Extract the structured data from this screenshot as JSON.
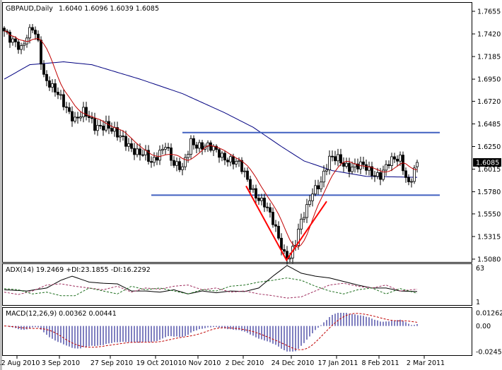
{
  "header": {
    "symbol": "GBPAUD,Daily",
    "ohlc": "1.6040 1.6096 1.6039 1.6085"
  },
  "adx_label": "ADX(14) 19.2469 +DI:23.1855 -DI:16.2292",
  "macd_label": "MACD(12,26,9) 0.00362 0.00441",
  "colors": {
    "bull": "#ffffff",
    "bear": "#000000",
    "ma_fast": "#c00000",
    "ma_slow": "#000080",
    "level": "#4060c0",
    "v_pattern": "#ff0000",
    "adx": "#000000",
    "plus_di": "#a03060",
    "minus_di": "#207020",
    "macd_hist": "#000080",
    "macd_signal": "#c00000"
  },
  "chart_data": {
    "type": "candlestick",
    "title": "GBPAUD,Daily",
    "price_axis": {
      "ticks": [
        "1.7655",
        "1.7420",
        "1.7185",
        "1.6950",
        "1.6720",
        "1.6485",
        "1.6250",
        "1.6015",
        "1.5780",
        "1.5550",
        "1.5315",
        "1.5080"
      ],
      "current": "1.6085"
    },
    "x_ticks": [
      {
        "bar": 5,
        "label": "12 Aug 2010"
      },
      {
        "bar": 20,
        "label": "3 Sep 2010"
      },
      {
        "bar": 38,
        "label": "27 Sep 2010"
      },
      {
        "bar": 54,
        "label": "19 Oct 2010"
      },
      {
        "bar": 69,
        "label": "10 Nov 2010"
      },
      {
        "bar": 85,
        "label": "2 Dec 2010"
      },
      {
        "bar": 102,
        "label": "24 Dec 2010"
      },
      {
        "bar": 118,
        "label": "17 Jan 2011"
      },
      {
        "bar": 133,
        "label": "8 Feb 2011"
      },
      {
        "bar": 149,
        "label": "2 Mar 2011"
      }
    ],
    "bars": 147,
    "close_anchors": [
      [
        0,
        1.745
      ],
      [
        4,
        1.735
      ],
      [
        6,
        1.725
      ],
      [
        10,
        1.748
      ],
      [
        12,
        1.735
      ],
      [
        14,
        1.7
      ],
      [
        17,
        1.685
      ],
      [
        22,
        1.665
      ],
      [
        25,
        1.655
      ],
      [
        28,
        1.66
      ],
      [
        32,
        1.645
      ],
      [
        36,
        1.65
      ],
      [
        40,
        1.635
      ],
      [
        45,
        1.625
      ],
      [
        50,
        1.615
      ],
      [
        52,
        1.605
      ],
      [
        55,
        1.62
      ],
      [
        57,
        1.63
      ],
      [
        60,
        1.605
      ],
      [
        63,
        1.6
      ],
      [
        66,
        1.632
      ],
      [
        70,
        1.625
      ],
      [
        75,
        1.62
      ],
      [
        80,
        1.612
      ],
      [
        83,
        1.605
      ],
      [
        85,
        1.595
      ],
      [
        88,
        1.58
      ],
      [
        92,
        1.565
      ],
      [
        95,
        1.545
      ],
      [
        97,
        1.53
      ],
      [
        99,
        1.515
      ],
      [
        101,
        1.512
      ],
      [
        103,
        1.525
      ],
      [
        105,
        1.545
      ],
      [
        107,
        1.56
      ],
      [
        109,
        1.58
      ],
      [
        112,
        1.59
      ],
      [
        115,
        1.61
      ],
      [
        118,
        1.612
      ],
      [
        122,
        1.605
      ],
      [
        127,
        1.603
      ],
      [
        130,
        1.598
      ],
      [
        133,
        1.597
      ],
      [
        136,
        1.607
      ],
      [
        140,
        1.612
      ],
      [
        143,
        1.588
      ],
      [
        146,
        1.6085
      ]
    ],
    "slow_ma_anchors": [
      [
        0,
        1.695
      ],
      [
        9,
        1.71
      ],
      [
        21,
        1.713
      ],
      [
        31,
        1.71
      ],
      [
        48,
        1.695
      ],
      [
        63,
        1.68
      ],
      [
        78,
        1.66
      ],
      [
        88,
        1.645
      ],
      [
        98,
        1.625
      ],
      [
        106,
        1.61
      ],
      [
        116,
        1.6
      ],
      [
        128,
        1.594
      ],
      [
        146,
        1.593
      ]
    ],
    "levels": [
      {
        "price": 1.6395,
        "from_bar": 63
      },
      {
        "price": 1.5745,
        "from_bar": 52
      }
    ],
    "v_pattern": [
      [
        85.5,
        1.584
      ],
      [
        99.8,
        1.507
      ],
      [
        114,
        1.568
      ]
    ],
    "adx": {
      "range": [
        1,
        63
      ],
      "ticks": [
        "63",
        "1"
      ],
      "adx": [
        [
          0,
          22
        ],
        [
          8,
          20
        ],
        [
          15,
          25
        ],
        [
          20,
          38
        ],
        [
          24,
          45
        ],
        [
          30,
          35
        ],
        [
          35,
          33
        ],
        [
          40,
          32
        ],
        [
          45,
          20
        ],
        [
          50,
          20
        ],
        [
          55,
          18
        ],
        [
          60,
          22
        ],
        [
          65,
          15
        ],
        [
          70,
          20
        ],
        [
          75,
          17
        ],
        [
          80,
          20
        ],
        [
          85,
          19
        ],
        [
          90,
          25
        ],
        [
          95,
          45
        ],
        [
          100,
          63
        ],
        [
          105,
          50
        ],
        [
          110,
          45
        ],
        [
          115,
          42
        ],
        [
          120,
          36
        ],
        [
          125,
          30
        ],
        [
          130,
          25
        ],
        [
          135,
          25
        ],
        [
          140,
          20
        ],
        [
          146,
          19
        ]
      ],
      "plus_di": [
        [
          0,
          18
        ],
        [
          5,
          14
        ],
        [
          10,
          20
        ],
        [
          15,
          30
        ],
        [
          20,
          32
        ],
        [
          25,
          28
        ],
        [
          30,
          25
        ],
        [
          35,
          22
        ],
        [
          40,
          28
        ],
        [
          45,
          18
        ],
        [
          50,
          25
        ],
        [
          55,
          23
        ],
        [
          60,
          28
        ],
        [
          65,
          30
        ],
        [
          70,
          22
        ],
        [
          75,
          25
        ],
        [
          80,
          18
        ],
        [
          85,
          20
        ],
        [
          90,
          15
        ],
        [
          95,
          12
        ],
        [
          100,
          8
        ],
        [
          105,
          10
        ],
        [
          110,
          20
        ],
        [
          115,
          30
        ],
        [
          120,
          33
        ],
        [
          125,
          28
        ],
        [
          130,
          25
        ],
        [
          135,
          30
        ],
        [
          140,
          20
        ],
        [
          146,
          23
        ]
      ],
      "minus_di": [
        [
          0,
          24
        ],
        [
          5,
          22
        ],
        [
          10,
          15
        ],
        [
          15,
          18
        ],
        [
          20,
          12
        ],
        [
          25,
          12
        ],
        [
          30,
          25
        ],
        [
          35,
          20
        ],
        [
          40,
          15
        ],
        [
          45,
          28
        ],
        [
          50,
          22
        ],
        [
          55,
          25
        ],
        [
          60,
          20
        ],
        [
          65,
          15
        ],
        [
          70,
          22
        ],
        [
          75,
          20
        ],
        [
          80,
          28
        ],
        [
          85,
          30
        ],
        [
          90,
          35
        ],
        [
          95,
          38
        ],
        [
          100,
          42
        ],
        [
          105,
          38
        ],
        [
          110,
          28
        ],
        [
          115,
          20
        ],
        [
          120,
          15
        ],
        [
          125,
          22
        ],
        [
          130,
          25
        ],
        [
          135,
          15
        ],
        [
          140,
          24
        ],
        [
          146,
          16
        ]
      ]
    },
    "macd": {
      "range": [
        -0.02459,
        0.01262
      ],
      "ticks": [
        "0.01262",
        "0.00",
        "-0.02459"
      ]
    }
  }
}
